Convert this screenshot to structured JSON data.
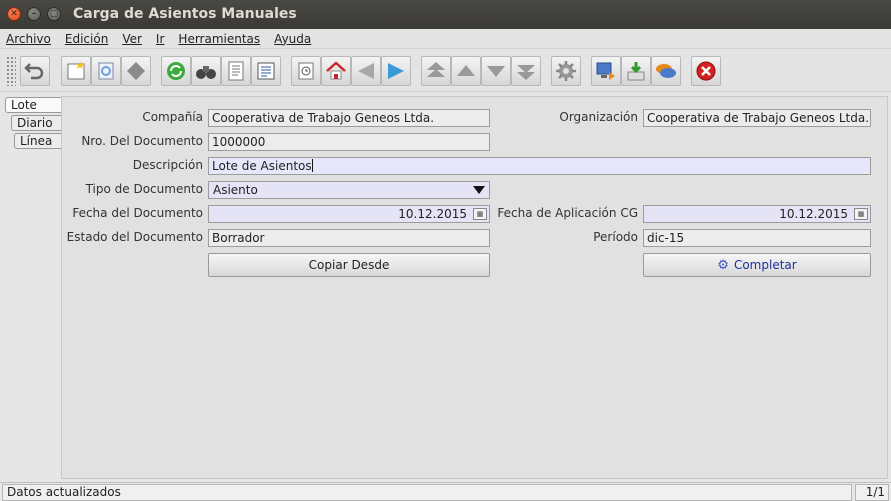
{
  "window": {
    "title": "Carga de Asientos Manuales"
  },
  "menu": [
    {
      "mnemonic": "A",
      "rest": "rchivo"
    },
    {
      "mnemonic": "E",
      "rest": "dición"
    },
    {
      "mnemonic": "V",
      "rest": "er"
    },
    {
      "mnemonic": "I",
      "rest": "r"
    },
    {
      "mnemonic": "H",
      "rest": "erramientas"
    },
    {
      "mnemonic": "A",
      "rest": "yuda"
    }
  ],
  "toolbar_icons": [
    "undo-icon",
    "new-record-icon",
    "copy-record-icon",
    "delete-record-icon",
    "refresh-icon",
    "find-icon",
    "report-icon",
    "form-view-icon",
    "history-icon",
    "home-icon",
    "back-icon",
    "forward-icon",
    "first-record-icon",
    "previous-record-icon",
    "next-record-icon",
    "last-record-icon",
    "process-icon",
    "export-icon",
    "import-icon",
    "chat-icon",
    "exit-icon"
  ],
  "tabs": [
    "Lote",
    "Diario",
    "Línea"
  ],
  "form": {
    "company_label": "Compañía",
    "company_value": "Cooperativa de Trabajo Geneos Ltda.",
    "org_label": "Organización",
    "org_value": "Cooperativa de Trabajo Geneos Ltda.",
    "docno_label": "Nro. Del Documento",
    "docno_value": "1000000",
    "desc_label": "Descripción",
    "desc_value": "Lote de Asientos",
    "doctype_label": "Tipo de Documento",
    "doctype_value": "Asiento",
    "docdate_label": "Fecha del Documento",
    "docdate_value": "10.12.2015",
    "acctdate_label": "Fecha de Aplicación CG",
    "acctdate_value": "10.12.2015",
    "status_label": "Estado del Documento",
    "status_value": "Borrador",
    "period_label": "Período",
    "period_value": "dic-15",
    "copy_button": "Copiar Desde",
    "complete_button": "Completar"
  },
  "status": {
    "message": "Datos actualizados",
    "count": "1/1"
  }
}
